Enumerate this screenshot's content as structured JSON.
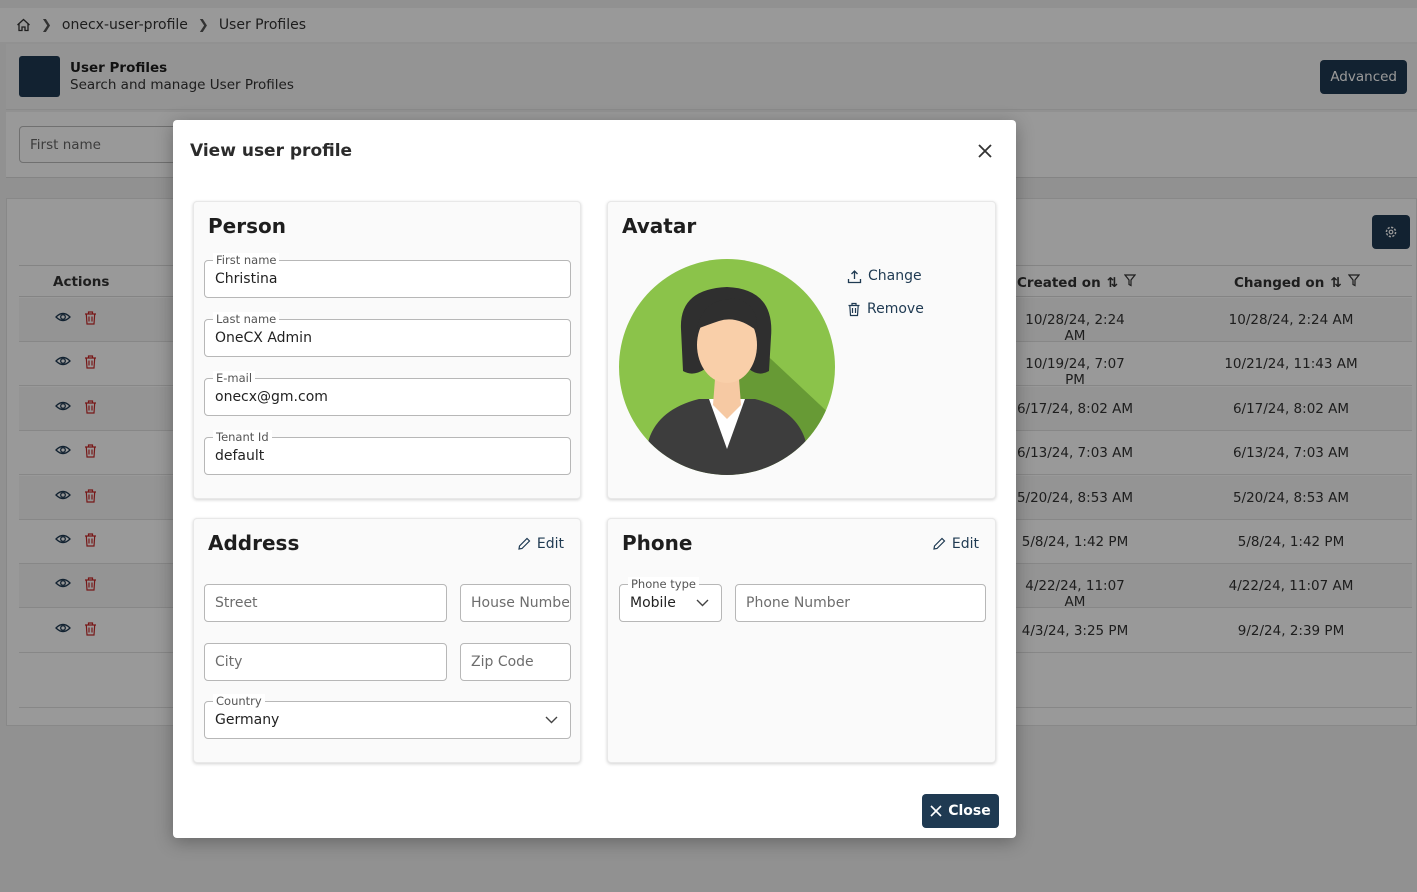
{
  "breadcrumb": {
    "items": [
      "onecx-user-profile",
      "User Profiles"
    ]
  },
  "header": {
    "title": "User Profiles",
    "subtitle": "Search and manage User Profiles",
    "advanced_label": "Advanced"
  },
  "search": {
    "first_name_placeholder": "First name"
  },
  "table": {
    "columns": {
      "actions": "Actions",
      "created_on": "Created on",
      "changed_on": "Changed on"
    },
    "rows": [
      {
        "created_on": "10/28/24, 2:24 AM",
        "changed_on": "10/28/24, 2:24 AM"
      },
      {
        "created_on": "10/19/24, 7:07 PM",
        "changed_on": "10/21/24, 11:43 AM"
      },
      {
        "created_on": "6/17/24, 8:02 AM",
        "changed_on": "6/17/24, 8:02 AM"
      },
      {
        "created_on": "6/13/24, 7:03 AM",
        "changed_on": "6/13/24, 7:03 AM"
      },
      {
        "created_on": "5/20/24, 8:53 AM",
        "changed_on": "5/20/24, 8:53 AM"
      },
      {
        "created_on": "5/8/24, 1:42 PM",
        "changed_on": "5/8/24, 1:42 PM"
      },
      {
        "created_on": "4/22/24, 11:07 AM",
        "changed_on": "4/22/24, 11:07 AM"
      },
      {
        "created_on": "4/3/24, 3:25 PM",
        "changed_on": "9/2/24, 2:39 PM"
      }
    ]
  },
  "dialog": {
    "title": "View user profile",
    "close_label": "Close",
    "person": {
      "title": "Person",
      "first_name": {
        "label": "First name",
        "value": "Christina"
      },
      "last_name": {
        "label": "Last name",
        "value": "OneCX Admin"
      },
      "email": {
        "label": "E-mail",
        "value": "onecx@gm.com"
      },
      "tenant": {
        "label": "Tenant Id",
        "value": "default"
      }
    },
    "avatar": {
      "title": "Avatar",
      "change_label": "Change",
      "remove_label": "Remove"
    },
    "address": {
      "title": "Address",
      "edit_label": "Edit",
      "street_placeholder": "Street",
      "house_number_placeholder": "House Number",
      "city_placeholder": "City",
      "zip_placeholder": "Zip Code",
      "country": {
        "label": "Country",
        "value": "Germany"
      }
    },
    "phone": {
      "title": "Phone",
      "edit_label": "Edit",
      "type": {
        "label": "Phone type",
        "value": "Mobile"
      },
      "number_placeholder": "Phone Number"
    }
  },
  "colors": {
    "primary": "#1f3a52",
    "danger": "#c62828",
    "avatar_green": "#7cb342"
  }
}
